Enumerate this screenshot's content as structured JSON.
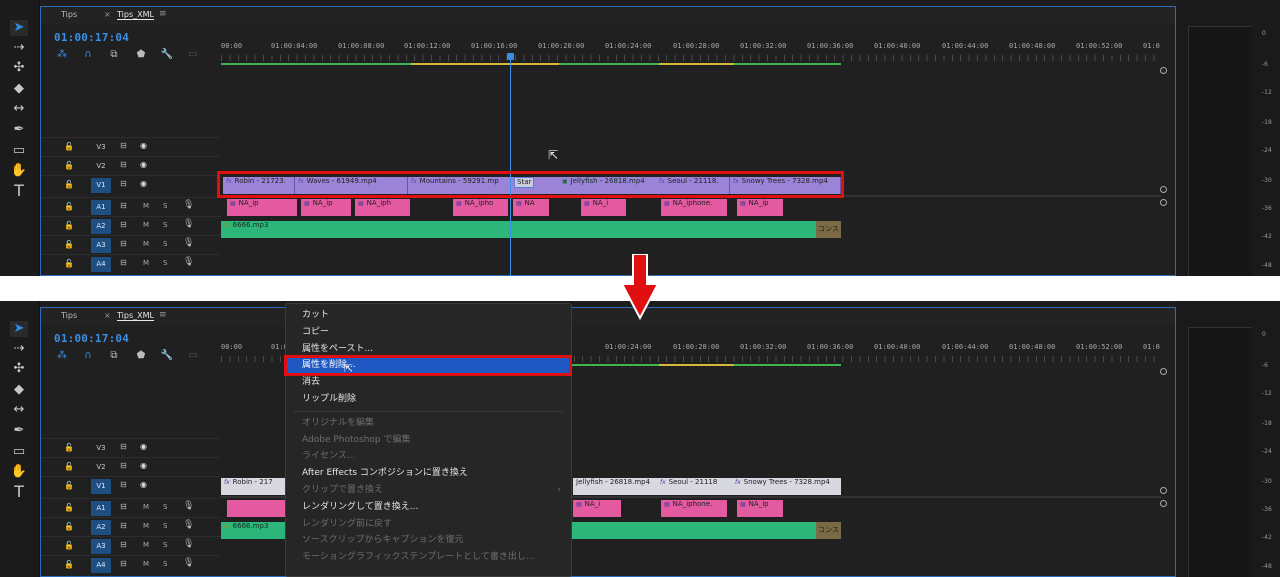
{
  "tabs": {
    "tab1": "Tips",
    "tab2": "Tips_XML",
    "close": "×",
    "menu": "≡"
  },
  "timecode": "01:00:17:04",
  "ruler": [
    "00:00",
    "01:00:04:00",
    "01:00:08:00",
    "01:00:12:00",
    "01:00:16:00",
    "01:00:20:00",
    "01:00:24:00",
    "01:00:28:00",
    "01:00:32:00",
    "01:00:36:00",
    "01:00:40:00",
    "01:00:44:00",
    "01:00:48:00",
    "01:00:52:00",
    "01:0"
  ],
  "tracks": {
    "video": [
      "V3",
      "V2",
      "V1"
    ],
    "audio": [
      "A1",
      "A2",
      "A3",
      "A4"
    ],
    "m": "M",
    "s": "S"
  },
  "video_clips": [
    {
      "label": "Robin - 21723."
    },
    {
      "label": "Waves - 61949.mp4"
    },
    {
      "label": "Mountains - 59291.mp"
    },
    {
      "label": "Star"
    },
    {
      "label": "Jellyfish - 26818.mp4"
    },
    {
      "label": "Seoul - 21118."
    },
    {
      "label": "Snowy Trees - 7328.mp4"
    }
  ],
  "video_clips_p2": [
    {
      "label": "Robin - 217"
    },
    {
      "label": "Jellyfish - 26818.mp4"
    },
    {
      "label": "Seoul - 21118"
    },
    {
      "label": "Snowy Trees - 7328.mp4"
    }
  ],
  "audio_clips": [
    "NA_ip",
    "NA_ip",
    "NA_iph",
    "NA_ipho",
    "NA",
    "NA_i",
    "NA_iphone.",
    "NA_ip"
  ],
  "audio_clips_p2": [
    "NA_i",
    "NA_iphone.",
    "NA_ip"
  ],
  "a2_clip": "6666.mp3",
  "a2_end": "コンス",
  "meter_labels": [
    "0",
    "-6",
    "-12",
    "-18",
    "-24",
    "-30",
    "-36",
    "-42",
    "-48"
  ],
  "context_menu": {
    "items": [
      {
        "label": "カット",
        "enabled": true
      },
      {
        "label": "コピー",
        "enabled": true
      },
      {
        "label": "属性をペースト...",
        "enabled": true
      },
      {
        "label": "属性を削除...",
        "enabled": true,
        "highlighted": true
      },
      {
        "label": "消去",
        "enabled": true
      },
      {
        "label": "リップル削除",
        "enabled": true
      },
      {
        "separator": true
      },
      {
        "label": "オリジナルを編集",
        "enabled": false
      },
      {
        "label": "Adobe Photoshop で編集",
        "enabled": false
      },
      {
        "label": "ライセンス...",
        "enabled": false
      },
      {
        "label": "After Effects コンポジションに置き換え",
        "enabled": true
      },
      {
        "label": "クリップで置き換え",
        "enabled": false,
        "submenu": true
      },
      {
        "label": "レンダリングして置き換え...",
        "enabled": true
      },
      {
        "label": "レンダリング前に戻す",
        "enabled": false
      },
      {
        "label": "ソースクリップからキャプションを復元",
        "enabled": false
      },
      {
        "label": "モーショングラフィックステンプレートとして書き出し...",
        "enabled": false
      }
    ]
  },
  "colors": {
    "accent": "#3a8fe4",
    "highlight": "#e01010",
    "menu_selected": "#1f57c3"
  }
}
